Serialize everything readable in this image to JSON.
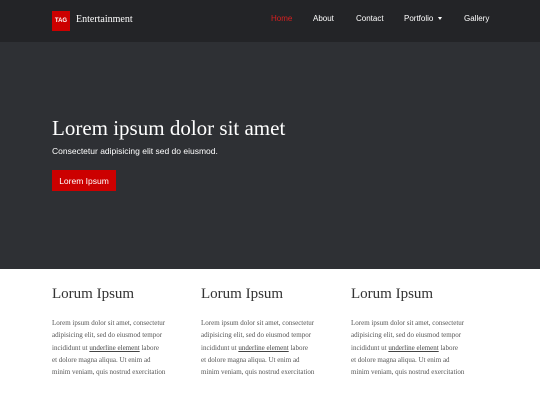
{
  "brand": {
    "logo_text": "TAG",
    "name": "Entertainment"
  },
  "nav": {
    "items": [
      "Home",
      "About",
      "Contact",
      "Portfolio",
      "Gallery"
    ],
    "active_index": 0,
    "active_color": "#d62020"
  },
  "hero": {
    "title": "Lorem ipsum dolor sit amet",
    "subtitle": "Consectetur adipisicing elit sed do eiusmod.",
    "button_label": "Lorem Ipsum",
    "background_color": "#2e3034",
    "accent_color": "#cc0000"
  },
  "columns": [
    {
      "title": "Lorum Ipsum",
      "line1": "Lorem ipsum dolor sit amet, consectetur",
      "line2": "adipisicing elit, sed do eiusmod tempor",
      "line3_before": "incididunt ut ",
      "line3_link": "underline element",
      "line3_after": " labore",
      "line4": "et dolore magna aliqua. Ut enim ad",
      "line5": "minim veniam, quis nostrud exercitation"
    },
    {
      "title": "Lorum Ipsum",
      "line1": "Lorem ipsum dolor sit amet, consectetur",
      "line2": "adipisicing elit, sed do eiusmod tempor",
      "line3_before": "incididunt ut ",
      "line3_link": "underline element",
      "line3_after": " labore",
      "line4": "et dolore magna aliqua. Ut enim ad",
      "line5": "minim veniam, quis nostrud exercitation"
    },
    {
      "title": "Lorum Ipsum",
      "line1": "Lorem ipsum dolor sit amet, consectetur",
      "line2": "adipisicing elit, sed do eiusmod tempor",
      "line3_before": "incididunt ut ",
      "line3_link": "underline element",
      "line3_after": " labore",
      "line4": "et dolore magna aliqua. Ut enim ad",
      "line5": "minim veniam, quis nostrud exercitation"
    }
  ]
}
